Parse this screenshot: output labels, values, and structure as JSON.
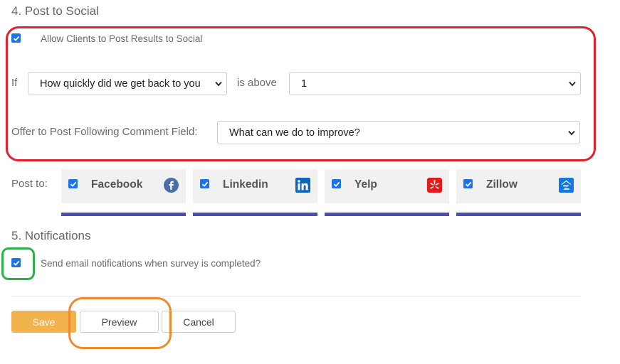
{
  "sections": {
    "post_to_social": {
      "heading": "4. Post to Social",
      "allow_label": "Allow Clients to Post Results to Social",
      "allow_checked": true,
      "if_label": "If",
      "question_value": "How quickly did we get back to you",
      "condition_label": "is above",
      "threshold_value": "1",
      "offer_label": "Offer to Post Following Comment Field:",
      "comment_field_value": "What can we do to improve?",
      "post_to_label": "Post to:",
      "networks": [
        {
          "name": "Facebook",
          "checked": true,
          "icon": "facebook-icon",
          "color": "#3b5998"
        },
        {
          "name": "Linkedin",
          "checked": true,
          "icon": "linkedin-icon",
          "color": "#0a66c2"
        },
        {
          "name": "Yelp",
          "checked": true,
          "icon": "yelp-icon",
          "color": "#e41b17"
        },
        {
          "name": "Zillow",
          "checked": true,
          "icon": "zillow-icon",
          "color": "#1277e1"
        }
      ]
    },
    "notifications": {
      "heading": "5. Notifications",
      "email_label": "Send email notifications when survey is completed?",
      "email_checked": true
    }
  },
  "actions": {
    "save_label": "Save",
    "preview_label": "Preview",
    "cancel_label": "Cancel"
  },
  "colors": {
    "accent_blue": "#1a73e8",
    "save_orange": "#f2b24e",
    "network_bar": "#4a4db3",
    "highlight_red": "#e0202b",
    "highlight_green": "#2fb14a",
    "highlight_orange": "#f08a2c"
  }
}
